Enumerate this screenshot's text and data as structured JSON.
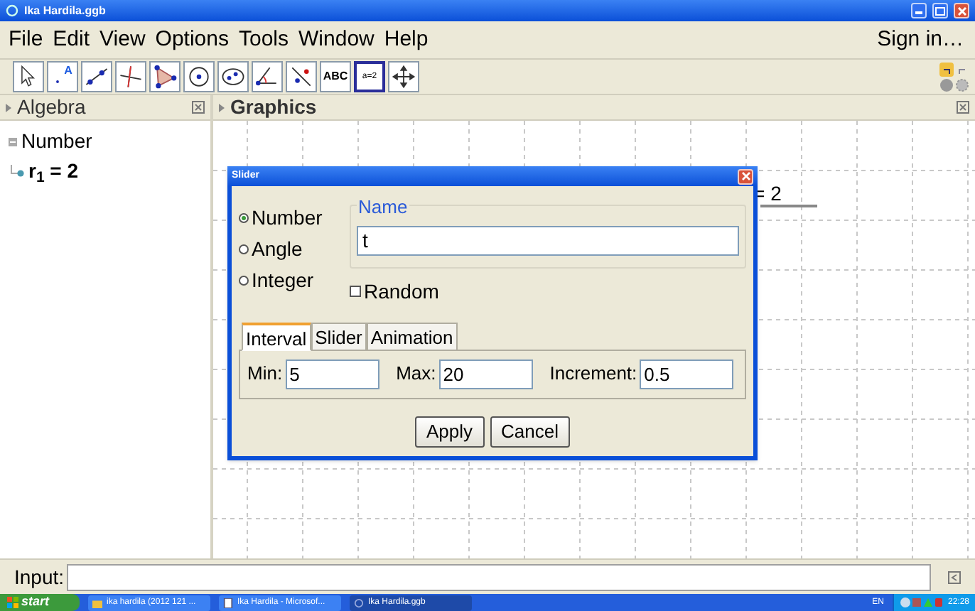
{
  "window": {
    "title": "Ika Hardila.ggb"
  },
  "menu": [
    "File",
    "Edit",
    "View",
    "Options",
    "Tools",
    "Window",
    "Help"
  ],
  "sign_in": "Sign in…",
  "tools": [
    {
      "kind": "move",
      "selected": false
    },
    {
      "kind": "point",
      "label": "A",
      "selected": false
    },
    {
      "kind": "line",
      "selected": false
    },
    {
      "kind": "perpendicular",
      "selected": false
    },
    {
      "kind": "polygon",
      "selected": false
    },
    {
      "kind": "circle",
      "selected": false
    },
    {
      "kind": "ellipse",
      "selected": false
    },
    {
      "kind": "angle",
      "selected": false
    },
    {
      "kind": "reflect",
      "selected": false
    },
    {
      "kind": "text",
      "label": "ABC",
      "selected": false
    },
    {
      "kind": "slider",
      "label": "a=2",
      "selected": true
    },
    {
      "kind": "pan",
      "selected": false
    }
  ],
  "algebra": {
    "title": "Algebra",
    "tree": [
      {
        "label": "Number",
        "children": [
          {
            "label": "**r$_{1}$ = 2**"
          }
        ]
      }
    ]
  },
  "graphics": {
    "title": "Graphics",
    "object_label": "= 2"
  },
  "dialog": {
    "title": "Slider",
    "types": [
      {
        "label": "Number",
        "selected": true
      },
      {
        "label": "Angle",
        "selected": false
      },
      {
        "label": "Integer",
        "selected": false
      }
    ],
    "name_label": "Name",
    "name_value": "t",
    "random": {
      "label": "Random",
      "checked": false
    },
    "tabs": [
      {
        "label": "Interval",
        "selected": true
      },
      {
        "label": "Slider",
        "selected": false
      },
      {
        "label": "Animation",
        "selected": false
      }
    ],
    "fields": [
      {
        "label": "Min:",
        "value": "5"
      },
      {
        "label": "Max:",
        "value": "20"
      },
      {
        "label": "Increment:",
        "value": "0.5"
      }
    ],
    "buttons": [
      "Apply",
      "Cancel"
    ]
  },
  "input_bar": {
    "label": "Input:"
  },
  "taskbar": {
    "start": "start",
    "tasks": [
      {
        "label": "ika hardila (2012 121 ...",
        "kind": "folder",
        "selected": false
      },
      {
        "label": "Ika Hardila - Microsof...",
        "kind": "document",
        "selected": false
      },
      {
        "label": "Ika Hardila.ggb",
        "kind": "app",
        "selected": true
      }
    ],
    "language": "EN",
    "clock": "22:28"
  }
}
